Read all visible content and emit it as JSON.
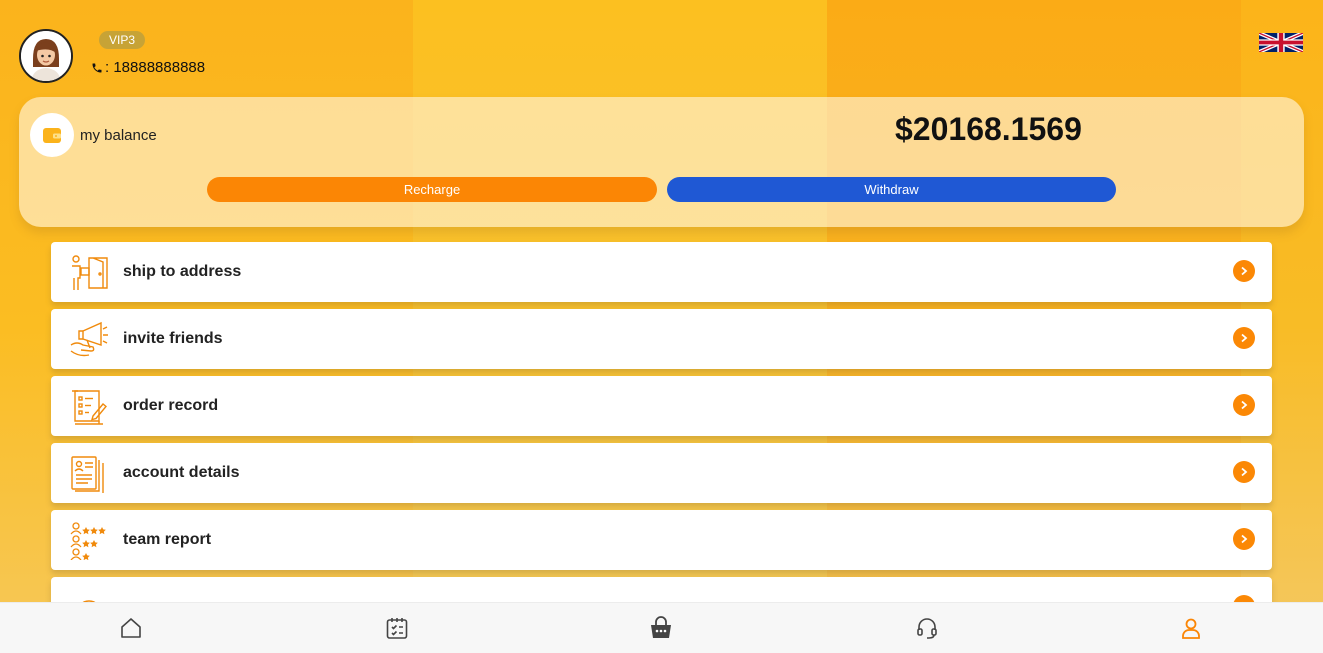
{
  "header": {
    "vip_badge": "VIP3",
    "phone_prefix": ":",
    "phone_number": "18888888888",
    "language_icon": "uk-flag-icon"
  },
  "balance": {
    "label": "my balance",
    "amount": "$20168.1569",
    "recharge_label": "Recharge",
    "withdraw_label": "Withdraw"
  },
  "menu": {
    "items": [
      {
        "label": "ship to address",
        "icon": "delivery-icon"
      },
      {
        "label": "invite friends",
        "icon": "megaphone-icon"
      },
      {
        "label": "order record",
        "icon": "checklist-icon"
      },
      {
        "label": "account details",
        "icon": "document-icon"
      },
      {
        "label": "team report",
        "icon": "team-stars-icon"
      },
      {
        "label": "",
        "icon": "star-badge-icon"
      }
    ]
  },
  "nav": {
    "items": [
      "home-icon",
      "calendar-icon",
      "shop-bag-icon",
      "headset-icon",
      "user-icon"
    ],
    "active_index": 4
  },
  "colors": {
    "accent": "#fb8605",
    "withdraw": "#1f58d4",
    "vip": "#c7a336"
  }
}
